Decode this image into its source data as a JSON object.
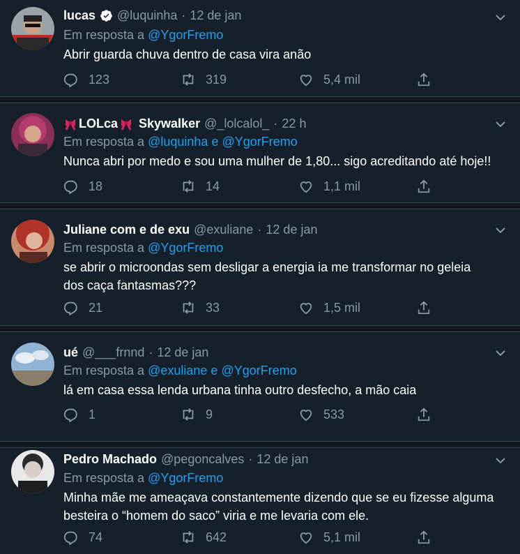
{
  "reply_prefix": "Em resposta a",
  "and_word": "e",
  "tweets": [
    {
      "name": "lucas",
      "verified": true,
      "handle": "@luquinha",
      "time": "12 de jan",
      "mentions": [
        "@YgorFremo"
      ],
      "text_lines": [
        "Abrir guarda chuva dentro de casa vira anão"
      ],
      "replies": "123",
      "retweets": "319",
      "likes": "5,4 mil"
    },
    {
      "name": "LOLca",
      "name_suffix": "Skywalker",
      "handle": "@_lolcalol_",
      "time": "22 h",
      "mentions": [
        "@luquinha",
        "@YgorFremo"
      ],
      "text_lines": [
        "Nunca abri por medo e sou uma mulher de 1,80... sigo acreditando até hoje!!"
      ],
      "replies": "18",
      "retweets": "14",
      "likes": "1,1 mil"
    },
    {
      "name": "Juliane com e de exu",
      "handle": "@exuliane",
      "time": "12 de jan",
      "mentions": [
        "@YgorFremo"
      ],
      "text_lines": [
        "se abrir o microondas sem desligar a energia ia me transformar no geleia",
        "dos caça fantasmas???"
      ],
      "replies": "21",
      "retweets": "33",
      "likes": "1,5 mil"
    },
    {
      "name": "ué",
      "handle": "@___frnnd",
      "time": "12 de jan",
      "mentions": [
        "@exuliane",
        "@YgorFremo"
      ],
      "text_lines": [
        "lá em casa essa lenda urbana tinha outro desfecho, a mão caia"
      ],
      "replies": "1",
      "retweets": "9",
      "likes": "533"
    },
    {
      "name": "Pedro Machado",
      "handle": "@pegoncalves",
      "time": "12 de jan",
      "mentions": [
        "@YgorFremo"
      ],
      "text_lines": [
        "Minha mãe me ameaçava constantemente dizendo que se eu fizesse alguma",
        "besteira o “homem do saco” viria e me levaria com ele."
      ],
      "replies": "74",
      "retweets": "642",
      "likes": "5,1 mil"
    }
  ],
  "colors": {
    "background": "#15202b",
    "separator": "#10171e",
    "secondary_text": "#8899a6",
    "link": "#1da1f2",
    "emoji_ribbon": "#e0245e"
  }
}
